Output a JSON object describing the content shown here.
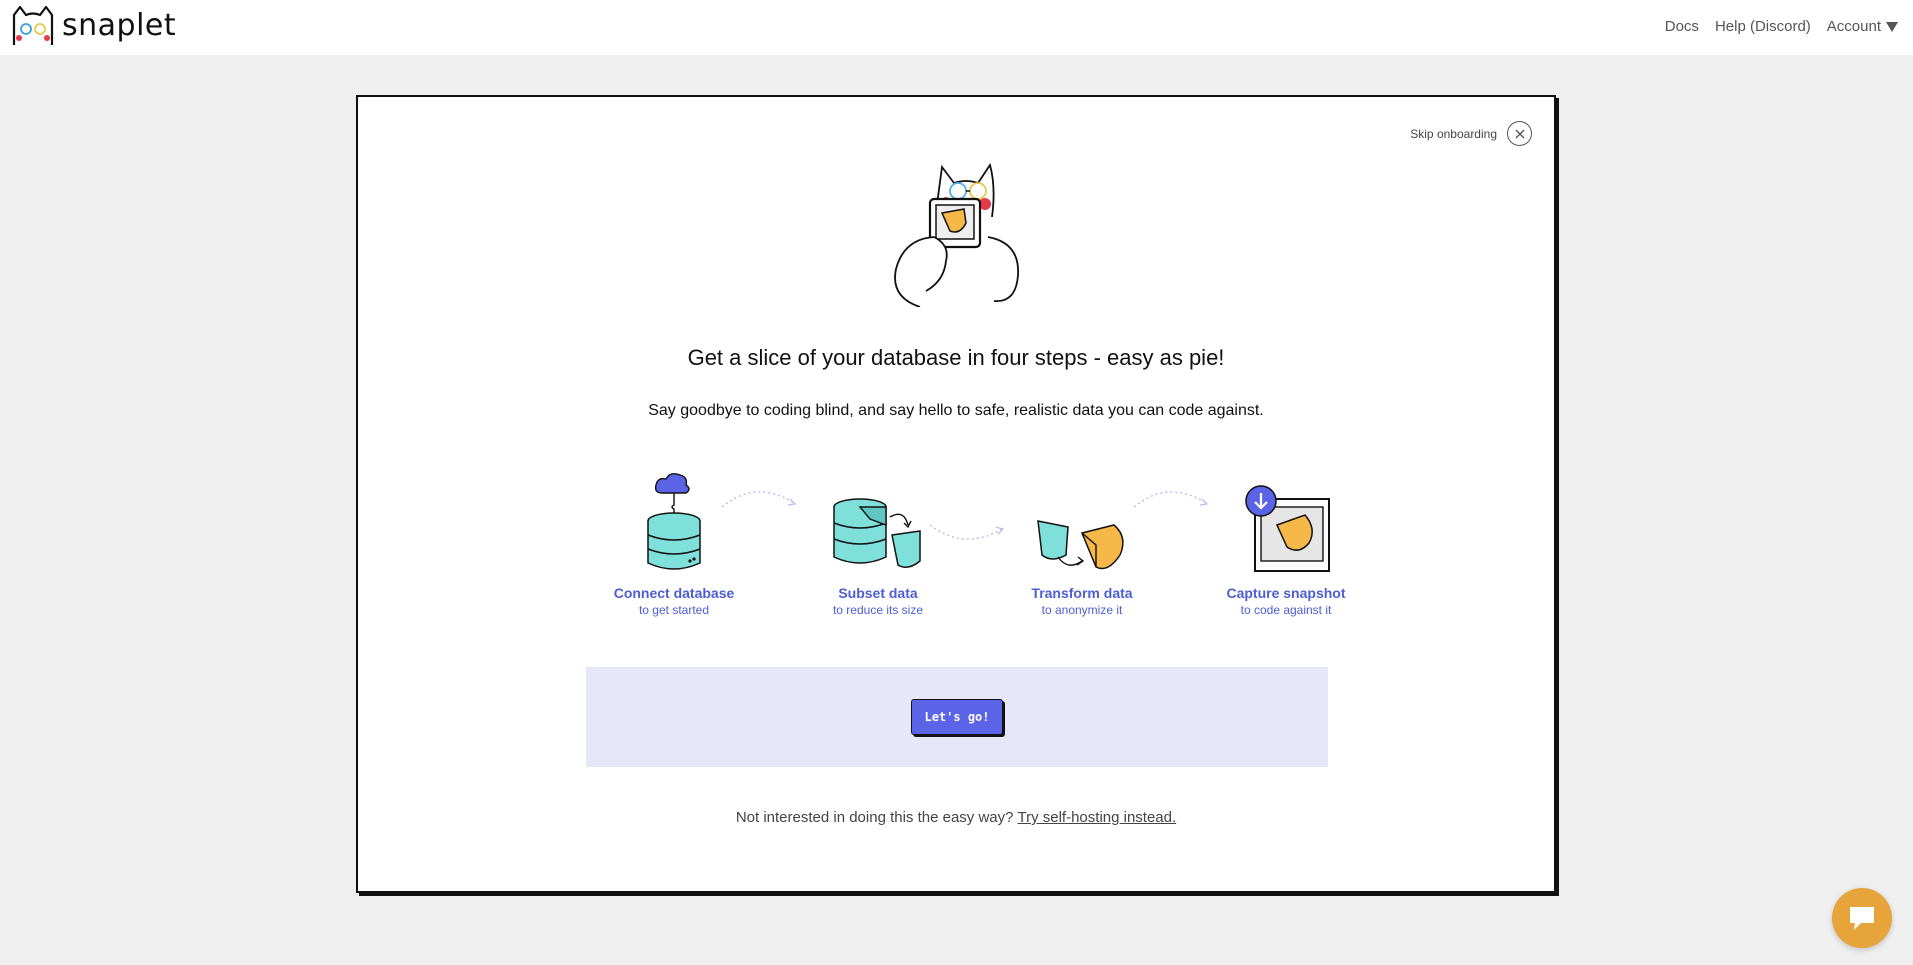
{
  "brand": {
    "name": "snaplet"
  },
  "nav": {
    "docs": "Docs",
    "help": "Help (Discord)",
    "account": "Account"
  },
  "onboarding": {
    "skip_label": "Skip onboarding",
    "headline": "Get a slice of your database in four steps - easy as pie!",
    "subline": "Say goodbye to coding blind, and say hello to safe, realistic data you can code against.",
    "steps": [
      {
        "title": "Connect database",
        "desc": "to get started",
        "icon": "database-cloud-icon"
      },
      {
        "title": "Subset data",
        "desc": "to reduce its size",
        "icon": "subset-data-icon"
      },
      {
        "title": "Transform data",
        "desc": "to anonymize it",
        "icon": "transform-data-icon"
      },
      {
        "title": "Capture snapshot",
        "desc": "to code against it",
        "icon": "capture-snapshot-icon"
      }
    ],
    "cta_label": "Let's go!",
    "footnote_prefix": "Not interested in doing this the easy way?",
    "footnote_link": "Try self-hosting instead."
  },
  "colors": {
    "accent": "#5b64e6",
    "step_text": "#4c5ed3",
    "cta_panel": "#e6e8fa",
    "teal": "#7fe0db",
    "pie": "#f7b84a",
    "chat": "#e6a43a"
  }
}
